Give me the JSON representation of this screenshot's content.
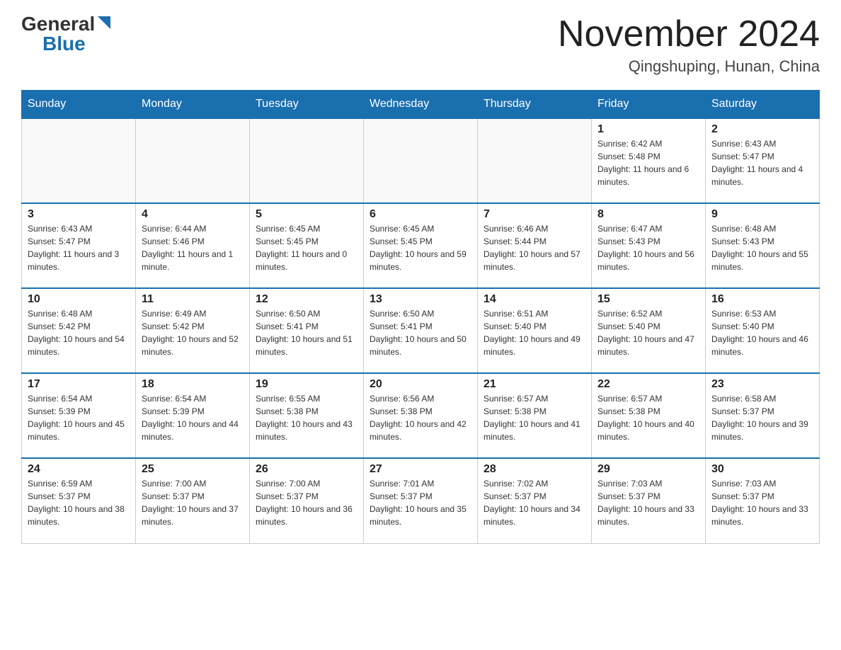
{
  "header": {
    "logo_general": "General",
    "logo_blue": "Blue",
    "month_title": "November 2024",
    "location": "Qingshuping, Hunan, China"
  },
  "days_of_week": [
    "Sunday",
    "Monday",
    "Tuesday",
    "Wednesday",
    "Thursday",
    "Friday",
    "Saturday"
  ],
  "weeks": [
    [
      {
        "day": "",
        "info": ""
      },
      {
        "day": "",
        "info": ""
      },
      {
        "day": "",
        "info": ""
      },
      {
        "day": "",
        "info": ""
      },
      {
        "day": "",
        "info": ""
      },
      {
        "day": "1",
        "info": "Sunrise: 6:42 AM\nSunset: 5:48 PM\nDaylight: 11 hours and 6 minutes."
      },
      {
        "day": "2",
        "info": "Sunrise: 6:43 AM\nSunset: 5:47 PM\nDaylight: 11 hours and 4 minutes."
      }
    ],
    [
      {
        "day": "3",
        "info": "Sunrise: 6:43 AM\nSunset: 5:47 PM\nDaylight: 11 hours and 3 minutes."
      },
      {
        "day": "4",
        "info": "Sunrise: 6:44 AM\nSunset: 5:46 PM\nDaylight: 11 hours and 1 minute."
      },
      {
        "day": "5",
        "info": "Sunrise: 6:45 AM\nSunset: 5:45 PM\nDaylight: 11 hours and 0 minutes."
      },
      {
        "day": "6",
        "info": "Sunrise: 6:45 AM\nSunset: 5:45 PM\nDaylight: 10 hours and 59 minutes."
      },
      {
        "day": "7",
        "info": "Sunrise: 6:46 AM\nSunset: 5:44 PM\nDaylight: 10 hours and 57 minutes."
      },
      {
        "day": "8",
        "info": "Sunrise: 6:47 AM\nSunset: 5:43 PM\nDaylight: 10 hours and 56 minutes."
      },
      {
        "day": "9",
        "info": "Sunrise: 6:48 AM\nSunset: 5:43 PM\nDaylight: 10 hours and 55 minutes."
      }
    ],
    [
      {
        "day": "10",
        "info": "Sunrise: 6:48 AM\nSunset: 5:42 PM\nDaylight: 10 hours and 54 minutes."
      },
      {
        "day": "11",
        "info": "Sunrise: 6:49 AM\nSunset: 5:42 PM\nDaylight: 10 hours and 52 minutes."
      },
      {
        "day": "12",
        "info": "Sunrise: 6:50 AM\nSunset: 5:41 PM\nDaylight: 10 hours and 51 minutes."
      },
      {
        "day": "13",
        "info": "Sunrise: 6:50 AM\nSunset: 5:41 PM\nDaylight: 10 hours and 50 minutes."
      },
      {
        "day": "14",
        "info": "Sunrise: 6:51 AM\nSunset: 5:40 PM\nDaylight: 10 hours and 49 minutes."
      },
      {
        "day": "15",
        "info": "Sunrise: 6:52 AM\nSunset: 5:40 PM\nDaylight: 10 hours and 47 minutes."
      },
      {
        "day": "16",
        "info": "Sunrise: 6:53 AM\nSunset: 5:40 PM\nDaylight: 10 hours and 46 minutes."
      }
    ],
    [
      {
        "day": "17",
        "info": "Sunrise: 6:54 AM\nSunset: 5:39 PM\nDaylight: 10 hours and 45 minutes."
      },
      {
        "day": "18",
        "info": "Sunrise: 6:54 AM\nSunset: 5:39 PM\nDaylight: 10 hours and 44 minutes."
      },
      {
        "day": "19",
        "info": "Sunrise: 6:55 AM\nSunset: 5:38 PM\nDaylight: 10 hours and 43 minutes."
      },
      {
        "day": "20",
        "info": "Sunrise: 6:56 AM\nSunset: 5:38 PM\nDaylight: 10 hours and 42 minutes."
      },
      {
        "day": "21",
        "info": "Sunrise: 6:57 AM\nSunset: 5:38 PM\nDaylight: 10 hours and 41 minutes."
      },
      {
        "day": "22",
        "info": "Sunrise: 6:57 AM\nSunset: 5:38 PM\nDaylight: 10 hours and 40 minutes."
      },
      {
        "day": "23",
        "info": "Sunrise: 6:58 AM\nSunset: 5:37 PM\nDaylight: 10 hours and 39 minutes."
      }
    ],
    [
      {
        "day": "24",
        "info": "Sunrise: 6:59 AM\nSunset: 5:37 PM\nDaylight: 10 hours and 38 minutes."
      },
      {
        "day": "25",
        "info": "Sunrise: 7:00 AM\nSunset: 5:37 PM\nDaylight: 10 hours and 37 minutes."
      },
      {
        "day": "26",
        "info": "Sunrise: 7:00 AM\nSunset: 5:37 PM\nDaylight: 10 hours and 36 minutes."
      },
      {
        "day": "27",
        "info": "Sunrise: 7:01 AM\nSunset: 5:37 PM\nDaylight: 10 hours and 35 minutes."
      },
      {
        "day": "28",
        "info": "Sunrise: 7:02 AM\nSunset: 5:37 PM\nDaylight: 10 hours and 34 minutes."
      },
      {
        "day": "29",
        "info": "Sunrise: 7:03 AM\nSunset: 5:37 PM\nDaylight: 10 hours and 33 minutes."
      },
      {
        "day": "30",
        "info": "Sunrise: 7:03 AM\nSunset: 5:37 PM\nDaylight: 10 hours and 33 minutes."
      }
    ]
  ]
}
